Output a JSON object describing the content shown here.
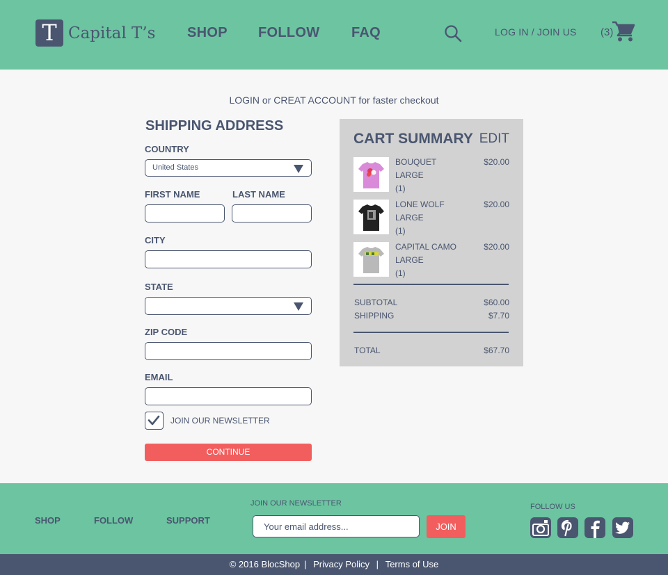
{
  "header": {
    "logo_letter": "T",
    "brand": "Capital T’s",
    "nav": [
      "SHOP",
      "FOLLOW",
      "FAQ"
    ],
    "login": "LOG IN / JOIN US",
    "cart_count": "(3)"
  },
  "main": {
    "promo": "LOGIN or CREAT ACCOUNT for faster checkout",
    "title": "SHIPPING ADDRESS",
    "country_label": "COUNTRY",
    "country_value": "United States",
    "first_name_label": "FIRST NAME",
    "last_name_label": "LAST NAME",
    "city_label": "CITY",
    "state_label": "STATE",
    "zip_label": "ZIP CODE",
    "email_label": "EMAIL",
    "newsletter_label": "JOIN OUR NEWSLETTER",
    "continue_label": "CONTINUE"
  },
  "cart": {
    "title": "CART SUMMARY",
    "edit": "EDIT",
    "items": [
      {
        "name": "BOUQUET",
        "size": "LARGE",
        "qty": "(1)",
        "price": "$20.00",
        "shirt_color": "#d98ad8"
      },
      {
        "name": "LONE WOLF",
        "size": "LARGE",
        "qty": "(1)",
        "price": "$20.00",
        "shirt_color": "#222222"
      },
      {
        "name": "CAPITAL CAMO",
        "size": "LARGE",
        "qty": "(1)",
        "price": "$20.00",
        "shirt_color": "#b9b9b9"
      }
    ],
    "subtotal_label": "SUBTOTAL",
    "subtotal": "$60.00",
    "shipping_label": "SHIPPING",
    "shipping": "$7.70",
    "total_label": "TOTAL",
    "total": "$67.70"
  },
  "footer": {
    "links": [
      "SHOP",
      "FOLLOW",
      "SUPPORT"
    ],
    "newsletter_label": "JOIN OUR NEWSLETTER",
    "email_placeholder": "Your email address...",
    "join_label": "JOIN",
    "follow_label": "FOLLOW US",
    "social_icons": [
      "instagram-icon",
      "pinterest-icon",
      "facebook-icon",
      "twitter-icon"
    ],
    "copyright": "© 2016 BlocShop",
    "privacy": "Privacy Policy",
    "terms": "Terms of Use",
    "separator": "|"
  },
  "colors": {
    "green": "#6cc4a1",
    "navy": "#4a5670",
    "red": "#f25e5e",
    "summary_bg": "#d2d2d2",
    "page_bg": "#f7f7f7"
  }
}
